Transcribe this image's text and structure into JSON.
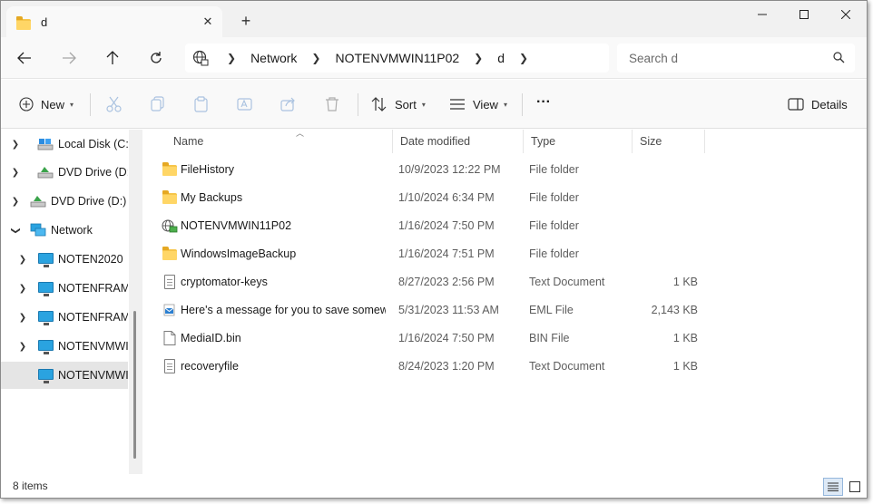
{
  "window": {
    "tab_title": "d",
    "new_tab_symbol": "+",
    "close_symbol": "✕"
  },
  "address": {
    "crumbs": [
      "Network",
      "NOTENVMWIN11P02",
      "d"
    ],
    "search_placeholder": "Search d"
  },
  "commands": {
    "new_label": "New",
    "sort_label": "Sort",
    "view_label": "View",
    "more_label": "···",
    "details_label": "Details"
  },
  "nav": {
    "items": [
      {
        "label": "Local Disk (C:)",
        "icon": "drive-icon"
      },
      {
        "label": "DVD Drive (D:)",
        "icon": "dvd-icon"
      },
      {
        "label": "DVD Drive (D:) C",
        "icon": "dvd-icon"
      },
      {
        "label": "Network",
        "icon": "network-icon"
      },
      {
        "label": "NOTEN2020",
        "icon": "computer-icon"
      },
      {
        "label": "NOTENFRAME",
        "icon": "computer-icon"
      },
      {
        "label": "NOTENFRAME",
        "icon": "computer-icon"
      },
      {
        "label": "NOTENVMWIN",
        "icon": "computer-icon"
      },
      {
        "label": "NOTENVMWIN",
        "icon": "computer-icon"
      }
    ]
  },
  "columns": {
    "name": "Name",
    "date": "Date modified",
    "type": "Type",
    "size": "Size"
  },
  "files": [
    {
      "name": "FileHistory",
      "date": "10/9/2023 12:22 PM",
      "type": "File folder",
      "size": "",
      "icon": "folder-icon"
    },
    {
      "name": "My Backups",
      "date": "1/10/2024 6:34 PM",
      "type": "File folder",
      "size": "",
      "icon": "folder-icon"
    },
    {
      "name": "NOTENVMWIN11P02",
      "date": "1/16/2024 7:50 PM",
      "type": "File folder",
      "size": "",
      "icon": "network-folder-icon"
    },
    {
      "name": "WindowsImageBackup",
      "date": "1/16/2024 7:51 PM",
      "type": "File folder",
      "size": "",
      "icon": "folder-icon"
    },
    {
      "name": "cryptomator-keys",
      "date": "8/27/2023 2:56 PM",
      "type": "Text Document",
      "size": "1 KB",
      "icon": "text-document-icon"
    },
    {
      "name": "Here's a message for you to save somew...",
      "date": "5/31/2023 11:53 AM",
      "type": "EML File",
      "size": "2,143 KB",
      "icon": "email-icon"
    },
    {
      "name": "MediaID.bin",
      "date": "1/16/2024 7:50 PM",
      "type": "BIN File",
      "size": "1 KB",
      "icon": "file-icon"
    },
    {
      "name": "recoveryfile",
      "date": "8/24/2023 1:20 PM",
      "type": "Text Document",
      "size": "1 KB",
      "icon": "text-document-icon"
    }
  ],
  "status": {
    "item_count": "8 items"
  }
}
